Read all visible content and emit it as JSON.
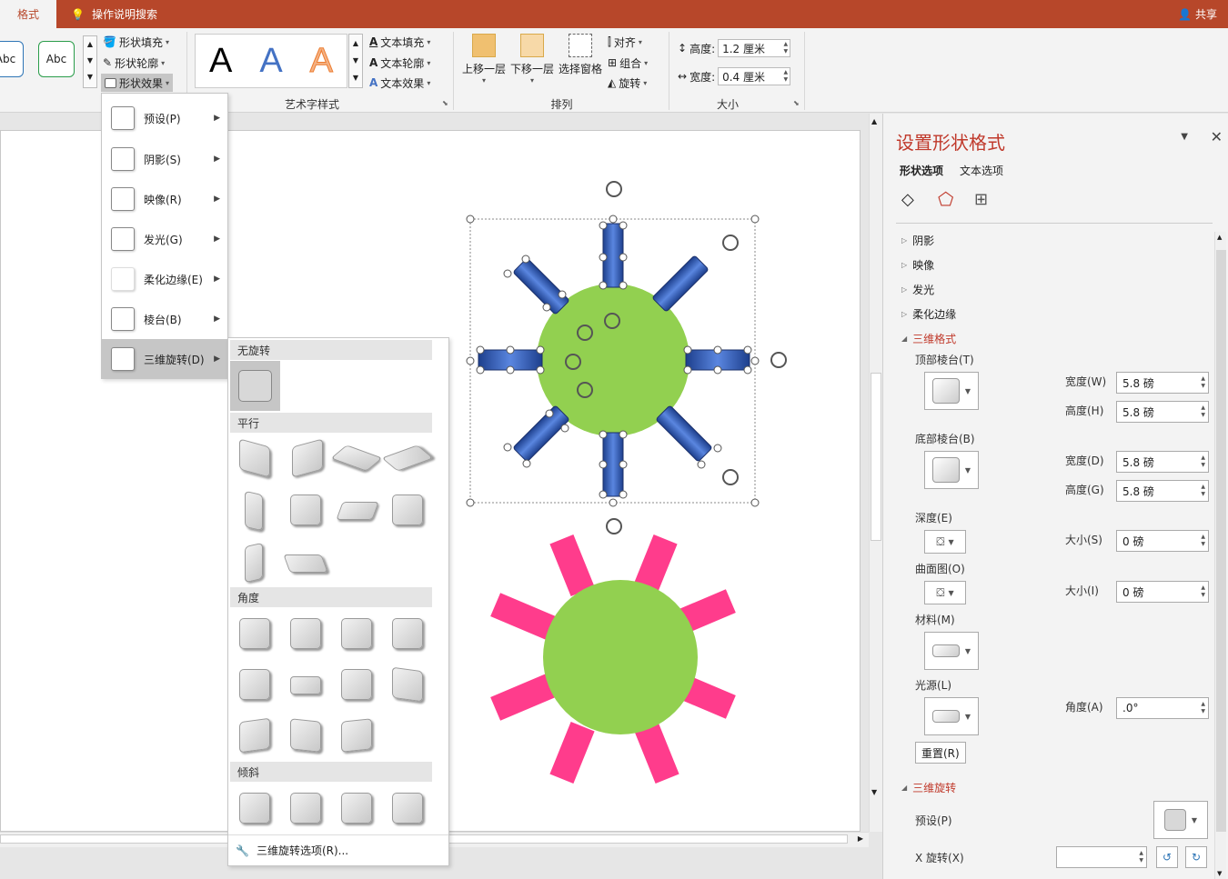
{
  "titlebar": {
    "active_tab": "格式",
    "search": "操作说明搜索",
    "share": "共享"
  },
  "ribbon": {
    "shape_styles": {
      "abc1": "Abc",
      "abc2": "Abc",
      "fill": "形状填充",
      "outline": "形状轮廓",
      "effects": "形状效果"
    },
    "wordart": {
      "sample": "A",
      "text_fill": "文本填充",
      "text_outline": "文本轮廓",
      "text_effects": "文本效果",
      "label": "艺术字样式"
    },
    "arrange": {
      "bring_forward": "上移一层",
      "send_backward": "下移一层",
      "selection_pane": "选择窗格",
      "align": "对齐",
      "group": "组合",
      "rotate": "旋转",
      "label": "排列"
    },
    "size": {
      "height_label": "高度:",
      "height_value": "1.2 厘米",
      "width_label": "宽度:",
      "width_value": "0.4 厘米",
      "label": "大小"
    }
  },
  "effects_menu": {
    "items": [
      {
        "label": "预设(P)"
      },
      {
        "label": "阴影(S)"
      },
      {
        "label": "映像(R)"
      },
      {
        "label": "发光(G)"
      },
      {
        "label": "柔化边缘(E)"
      },
      {
        "label": "棱台(B)"
      },
      {
        "label": "三维旋转(D)"
      }
    ]
  },
  "rotation_submenu": {
    "no_rotation": "无旋转",
    "parallel": "平行",
    "perspective": "角度",
    "oblique": "倾斜",
    "options": "三维旋转选项(R)..."
  },
  "pane": {
    "title": "设置形状格式",
    "tabs": {
      "shape": "形状选项",
      "text": "文本选项"
    },
    "sections": {
      "shadow": "阴影",
      "reflection": "映像",
      "glow": "发光",
      "soft_edges": "柔化边缘",
      "format3d": "三维格式",
      "rotation3d": "三维旋转"
    },
    "top_bevel": "顶部棱台(T)",
    "bottom_bevel": "底部棱台(B)",
    "width_w": "宽度(W)",
    "height_h": "高度(H)",
    "width_d": "宽度(D)",
    "height_g": "高度(G)",
    "top_width": "5.8 磅",
    "top_height": "5.8 磅",
    "bottom_width": "5.8 磅",
    "bottom_height": "5.8 磅",
    "depth": "深度(E)",
    "depth_size_label": "大小(S)",
    "depth_size": "0 磅",
    "contour": "曲面图(O)",
    "contour_size_label": "大小(I)",
    "contour_size": "0 磅",
    "material": "材料(M)",
    "lighting": "光源(L)",
    "angle_label": "角度(A)",
    "angle": ".0°",
    "reset": "重置(R)",
    "preset": "预设(P)",
    "x_rotation": "X 旋转(X)"
  },
  "colors": {
    "accent": "#b7472a",
    "pane_title": "#c0392b",
    "circle": "#92d050",
    "spokes_pink": "#ff3c8c",
    "spokes_blue": "#2f55b4"
  }
}
